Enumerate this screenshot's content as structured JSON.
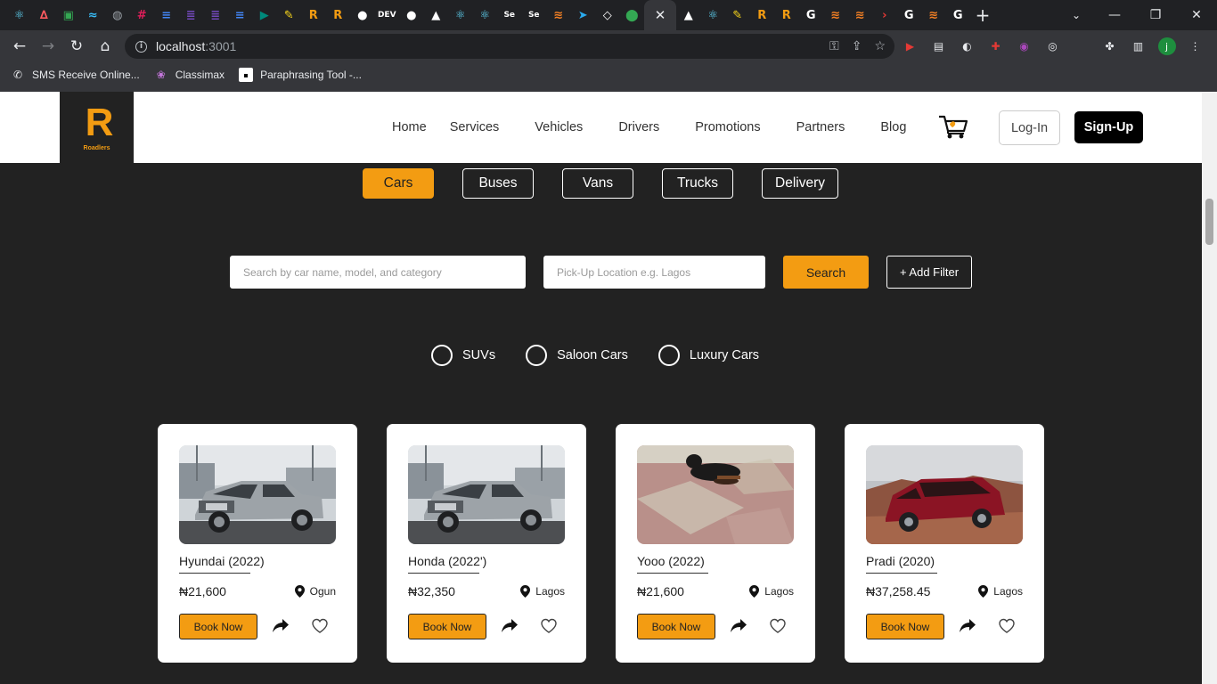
{
  "browser": {
    "url_host": "localhost",
    "url_port": ":3001",
    "active_tab_close": "✕",
    "new_tab": "+",
    "tabs": [
      {
        "icon": "react-icon",
        "color": "#61dafb",
        "glyph": "⚛"
      },
      {
        "icon": "airbnb-icon",
        "color": "#ff5a5f",
        "glyph": "∆"
      },
      {
        "icon": "sheets-icon",
        "color": "#34a853",
        "glyph": "▣"
      },
      {
        "icon": "tailwind-icon",
        "color": "#38bdf8",
        "glyph": "≈"
      },
      {
        "icon": "globe-icon",
        "color": "#9aa0a6",
        "glyph": "◍"
      },
      {
        "icon": "slack-icon",
        "color": "#e01e5a",
        "glyph": "#"
      },
      {
        "icon": "docs-icon",
        "color": "#4285f4",
        "glyph": "≡"
      },
      {
        "icon": "forms-icon",
        "color": "#7248b9",
        "glyph": "≣"
      },
      {
        "icon": "forms-icon",
        "color": "#7248b9",
        "glyph": "≣"
      },
      {
        "icon": "docs-icon",
        "color": "#4285f4",
        "glyph": "≡"
      },
      {
        "icon": "meet-icon",
        "color": "#00897b",
        "glyph": "▶"
      },
      {
        "icon": "note-icon",
        "color": "#f9d71c",
        "glyph": "✎"
      },
      {
        "icon": "roadlers-icon",
        "color": "#f39c12",
        "glyph": "R"
      },
      {
        "icon": "roadlers-icon",
        "color": "#f39c12",
        "glyph": "R"
      },
      {
        "icon": "github-icon",
        "color": "#ffffff",
        "glyph": "●"
      },
      {
        "icon": "dev-icon",
        "color": "#ffffff",
        "glyph": "DEV"
      },
      {
        "icon": "github-icon",
        "color": "#ffffff",
        "glyph": "●"
      },
      {
        "icon": "vercel-icon",
        "color": "#ffffff",
        "glyph": "▲"
      },
      {
        "icon": "react-icon",
        "color": "#61dafb",
        "glyph": "⚛"
      },
      {
        "icon": "react-icon",
        "color": "#61dafb",
        "glyph": "⚛"
      },
      {
        "icon": "selenium-icon",
        "color": "#ffffff",
        "glyph": "Se"
      },
      {
        "icon": "selenium-icon",
        "color": "#ffffff",
        "glyph": "Se"
      },
      {
        "icon": "stackoverflow-icon",
        "color": "#f48024",
        "glyph": "≋"
      },
      {
        "icon": "telegram-icon",
        "color": "#2aabee",
        "glyph": "➤"
      },
      {
        "icon": "codepen-icon",
        "color": "#ffffff",
        "glyph": "◇"
      },
      {
        "icon": "maps-icon",
        "color": "#34a853",
        "glyph": "⬤"
      }
    ],
    "tabs_after": [
      {
        "icon": "vercel-icon",
        "color": "#ffffff",
        "glyph": "▲"
      },
      {
        "icon": "react-icon",
        "color": "#61dafb",
        "glyph": "⚛"
      },
      {
        "icon": "note-icon",
        "color": "#f9d71c",
        "glyph": "✎"
      },
      {
        "icon": "roadlers-icon",
        "color": "#f39c12",
        "glyph": "R"
      },
      {
        "icon": "roadlers-icon",
        "color": "#f39c12",
        "glyph": "R"
      },
      {
        "icon": "google-icon",
        "color": "#ffffff",
        "glyph": "G"
      },
      {
        "icon": "stackoverflow-icon",
        "color": "#f48024",
        "glyph": "≋"
      },
      {
        "icon": "stackoverflow-icon",
        "color": "#f48024",
        "glyph": "≋"
      },
      {
        "icon": "arrow-icon",
        "color": "#e53935",
        "glyph": "›"
      },
      {
        "icon": "google-icon",
        "color": "#ffffff",
        "glyph": "G"
      },
      {
        "icon": "stackoverflow-icon",
        "color": "#f48024",
        "glyph": "≋"
      },
      {
        "icon": "google-icon",
        "color": "#ffffff",
        "glyph": "G"
      }
    ],
    "bookmarks": [
      {
        "label": "SMS Receive Online...",
        "icon": "phone-icon",
        "glyph": "✆"
      },
      {
        "label": "Classimax",
        "icon": "lotus-icon",
        "glyph": "❀"
      },
      {
        "label": "Paraphrasing Tool -...",
        "icon": "page-icon",
        "glyph": "▪"
      }
    ],
    "profile_initial": "j"
  },
  "header": {
    "logo_mark": "R",
    "logo_name": "Roadlers",
    "nav": [
      "Home",
      "Services",
      "Vehicles",
      "Drivers",
      "Promotions",
      "Partners",
      "Blog"
    ],
    "login": "Log-In",
    "signup": "Sign-Up"
  },
  "categories": [
    "Cars",
    "Buses",
    "Vans",
    "Trucks",
    "Delivery"
  ],
  "active_category": "Cars",
  "search": {
    "name_placeholder": "Search by car name, model, and category",
    "location_placeholder": "Pick-Up Location e.g. Lagos",
    "button": "Search",
    "filter_button": "+ Add Filter"
  },
  "car_types": [
    "SUVs",
    "Saloon Cars",
    "Luxury Cars"
  ],
  "cars": [
    {
      "title": "Hyundai (2022)",
      "price": "₦21,600",
      "location": "Ogun",
      "book": "Book Now",
      "image": "truck"
    },
    {
      "title": "Honda (2022')",
      "price": "₦32,350",
      "location": "Lagos",
      "book": "Book Now",
      "image": "truck"
    },
    {
      "title": "Yooo (2022)",
      "price": "₦21,600",
      "location": "Lagos",
      "book": "Book Now",
      "image": "dog"
    },
    {
      "title": "Pradi (2020)",
      "price": "₦37,258.45",
      "location": "Lagos",
      "book": "Book Now",
      "image": "van"
    }
  ],
  "colors": {
    "accent": "#f39c12",
    "page_bg": "#222222",
    "card_bg": "#ffffff"
  }
}
